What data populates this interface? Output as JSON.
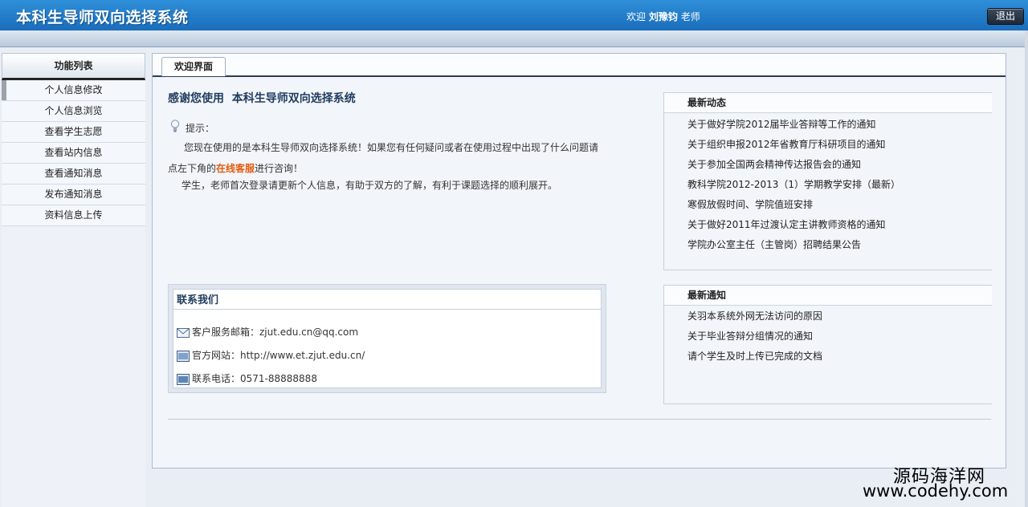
{
  "header": {
    "app_title": "本科生导师双向选择系统",
    "welcome_prefix": "欢迎",
    "user_name": "刘豫钧",
    "role": "老师",
    "logout_label": "退出"
  },
  "sidebar": {
    "title": "功能列表",
    "items": [
      {
        "label": "个人信息修改"
      },
      {
        "label": "个人信息浏览"
      },
      {
        "label": "查看学生志愿"
      },
      {
        "label": "查看站内信息"
      },
      {
        "label": "查看通知消息"
      },
      {
        "label": "发布通知消息"
      },
      {
        "label": "资料信息上传"
      }
    ]
  },
  "main": {
    "tab_label": "欢迎界面",
    "heading": "感谢您使用  本科生导师双向选择系统",
    "tip_label": "提示：",
    "tip_text_before": "您现在使用的是本科生导师双向选择系统！如果您有任何疑问或者在使用过程中出现了什么问题请点左下角的",
    "tip_link": "在线客服",
    "tip_text_after": "进行咨询！",
    "tip_text2": "学生，老师首次登录请更新个人信息，有助于双方的了解，有利于课题选择的顺利展开。"
  },
  "contact": {
    "title": "联系我们",
    "email": "客户服务邮箱：zjut.edu.cn@qq.com",
    "website": "官方网站：http://www.et.zjut.edu.cn/",
    "phone": "联系电话：0571-88888888"
  },
  "news": {
    "title": "最新动态",
    "items": [
      {
        "label": "关于做好学院2012届毕业答辩等工作的通知"
      },
      {
        "label": "关于组织申报2012年省教育厅科研项目的通知"
      },
      {
        "label": "关于参加全国两会精神传达报告会的通知"
      },
      {
        "label": "教科学院2012-2013（1）学期教学安排（最新）"
      },
      {
        "label": "寒假放假时间、学院值班安排"
      },
      {
        "label": "关于做好2011年过渡认定主讲教师资格的通知"
      },
      {
        "label": "学院办公室主任（主管岗）招聘结果公告"
      }
    ]
  },
  "notices": {
    "title": "最新通知",
    "items": [
      {
        "label": "关羽本系统外网无法访问的原因"
      },
      {
        "label": "关于毕业答辩分组情况的通知"
      },
      {
        "label": "请个学生及时上传已完成的文档"
      }
    ]
  },
  "watermark": {
    "line1": "源码海洋网",
    "line2": "www.codehy.com"
  }
}
